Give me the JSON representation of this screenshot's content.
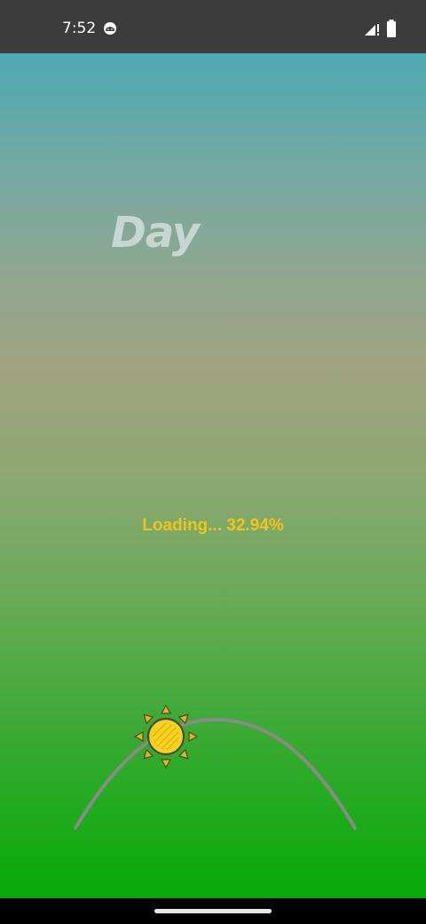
{
  "status_bar": {
    "time": "7:52",
    "app_icon": "android-robot-icon",
    "signal_icon": "signal-icon",
    "battery_icon": "battery-icon"
  },
  "main": {
    "title": "Day",
    "loading_text": "Loading... 32.94%",
    "sun_icon": "sun-icon"
  },
  "colors": {
    "title": "#c6d6d0",
    "loading": "#f2c41a",
    "arc": "#8a8a8a",
    "sun_fill": "#f7d21e",
    "sky_top": "#4fa9b2",
    "ground_bottom": "#06aa07"
  },
  "nav_bar": {
    "home_handle": "home-gesture-handle"
  }
}
